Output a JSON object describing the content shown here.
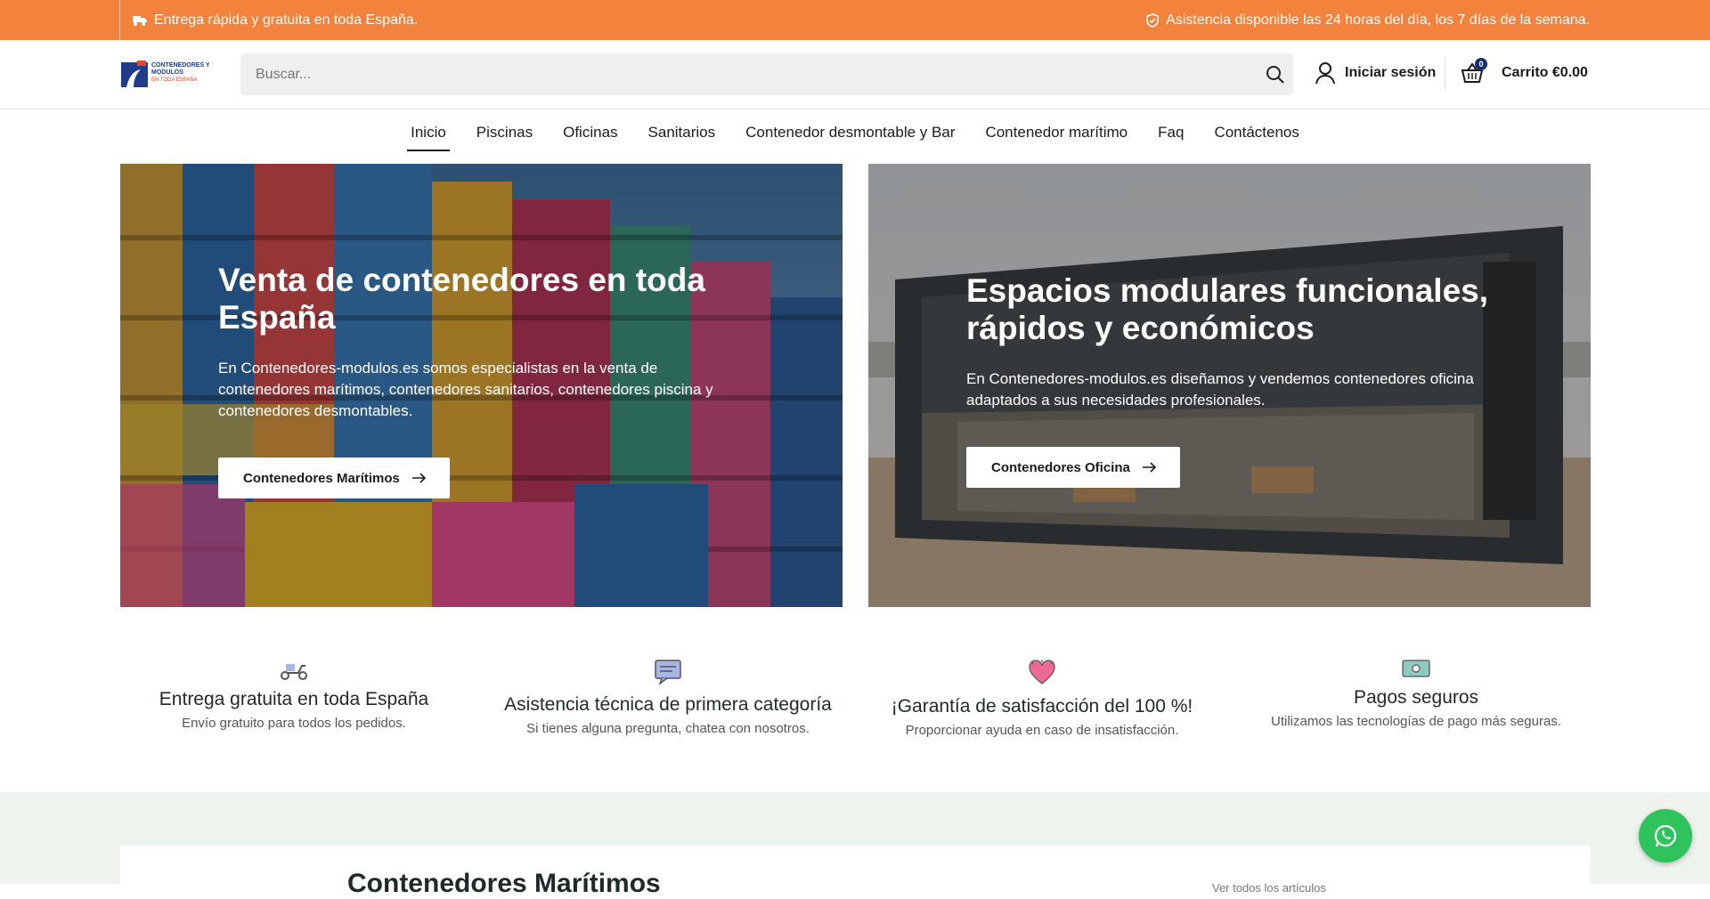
{
  "topbar": {
    "left_text": "Entrega rápida y gratuita en toda España.",
    "right_text": "Asistencia disponible las 24 horas del día, los 7 días de la semana."
  },
  "header": {
    "logo_line1": "CONTENEDORES Y",
    "logo_line2": "MODULOS",
    "logo_line3": "EN TODA ESPAÑA",
    "search_placeholder": "Buscar...",
    "account_label": "Iniciar sesión",
    "cart_count": "0",
    "cart_label": "Carrito €0.00"
  },
  "nav": {
    "items": [
      "Inicio",
      "Piscinas",
      "Oficinas",
      "Sanitarios",
      "Contenedor desmontable y Bar",
      "Contenedor marítimo",
      "Faq",
      "Contáctenos"
    ]
  },
  "hero": [
    {
      "title": "Venta de contenedores en toda España",
      "text": "En Contenedores-modulos.es somos especialistas en la venta de contenedores marítimos, contenedores sanitarios, contenedores piscina y contenedores desmontables.",
      "button": "Contenedores Marítimos"
    },
    {
      "title": "Espacios modulares funcionales, rápidos y económicos",
      "text": "En Contenedores-modulos.es diseñamos y vendemos contenedores oficina adaptados a sus necesidades profesionales.",
      "button": "Contenedores Oficina"
    }
  ],
  "features": [
    {
      "icon": "scooter-icon",
      "title": "Entrega gratuita en toda España",
      "text": "Envío gratuito para todos los pedidos."
    },
    {
      "icon": "chat-icon",
      "title": "Asistencia técnica de primera categoría",
      "text": "Si tienes alguna pregunta, chatea con nosotros."
    },
    {
      "icon": "heart-icon",
      "title": "¡Garantía de satisfacción del 100 %!",
      "text": "Proporcionar ayuda en caso de insatisfacción."
    },
    {
      "icon": "money-icon",
      "title": "Pagos seguros",
      "text": "Utilizamos las tecnologías de pago más seguras."
    }
  ],
  "lower": {
    "title": "Contenedores Marítimos",
    "tab": "Ver todos los artículos"
  },
  "colors": {
    "accent": "#f3823c",
    "whatsapp": "#2fc35c",
    "brand_blue": "#13306c"
  }
}
